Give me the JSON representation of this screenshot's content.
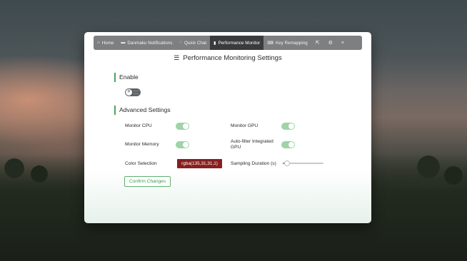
{
  "tabs": [
    {
      "icon": "⌂",
      "label": "Home"
    },
    {
      "icon": "▬",
      "label": "Danmaku Notifications"
    },
    {
      "icon": "◌",
      "label": "Quick Chat"
    },
    {
      "icon": "▮",
      "label": "Performance Monitor",
      "active": true
    },
    {
      "icon": "⌨",
      "label": "Key Remapping"
    }
  ],
  "window_buttons": {
    "pin": "⇱",
    "settings": "⚙",
    "close": "×"
  },
  "page_title": "Performance Monitoring Settings",
  "enable": {
    "heading": "Enable",
    "on": false
  },
  "advanced": {
    "heading": "Advanced Settings",
    "monitor_cpu": {
      "label": "Monitor CPU",
      "on": true
    },
    "monitor_gpu": {
      "label": "Monitor GPU",
      "on": true
    },
    "monitor_memory": {
      "label": "Monitor Memory",
      "on": true
    },
    "auto_filter_gpu": {
      "label": "Auto-filter Integrated GPU",
      "on": true
    },
    "color_selection": {
      "label": "Color Selection",
      "value": "rgba(135,31,31,1)",
      "color": "#871f1f"
    },
    "sampling_duration": {
      "label": "Sampling Duration (s)",
      "level_fraction": 0.1
    }
  },
  "confirm_label": "Confirm Changes",
  "colors": {
    "accent": "#45a75a",
    "switch_on": "#9fd3a8",
    "tabbar": "#7d7f81",
    "tab_active": "#3a3b3c"
  }
}
